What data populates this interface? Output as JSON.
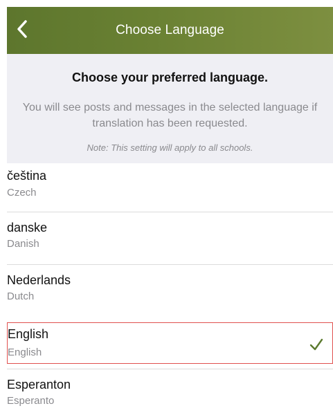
{
  "header": {
    "back_icon": "chevron-left-icon",
    "title": "Choose Language",
    "background_color": "#6a8133"
  },
  "info": {
    "heading": "Choose your preferred language.",
    "body": "You will see posts and messages in the selected language if translation has been requested.",
    "note": "Note: This setting will apply to all schools."
  },
  "languages": [
    {
      "native": "čeština",
      "english": "Czech",
      "selected": false
    },
    {
      "native": "danske",
      "english": "Danish",
      "selected": false
    },
    {
      "native": "Nederlands",
      "english": "Dutch",
      "selected": false
    },
    {
      "native": "English",
      "english": "English",
      "selected": true,
      "selected_icon": "checkmark-icon"
    },
    {
      "native": "Esperanton",
      "english": "Esperanto",
      "selected": false
    }
  ],
  "colors": {
    "accent": "#6a8133",
    "selection_outline": "#e0504e",
    "checkmark": "#5b7a2e",
    "secondary_text": "#8a8a8e",
    "panel_background": "#efeff4"
  }
}
